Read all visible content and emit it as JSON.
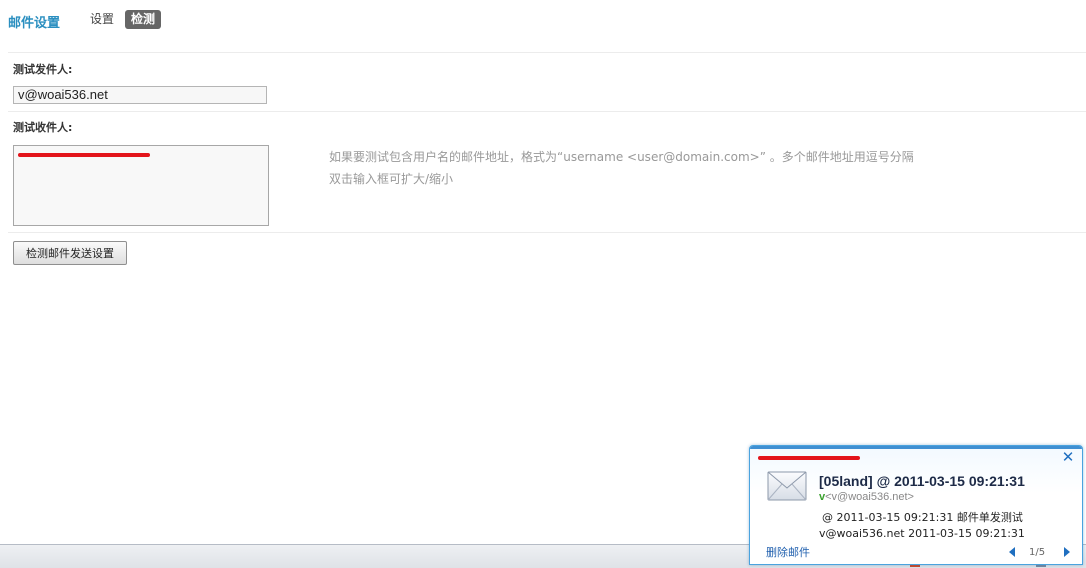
{
  "header": {
    "title": "邮件设置",
    "tabs": [
      {
        "label": "设置",
        "active": false
      },
      {
        "label": "检测",
        "active": true
      }
    ]
  },
  "form": {
    "sender_label": "测试发件人:",
    "sender_value": "v@woai536.net",
    "recipient_label": "测试收件人:",
    "recipient_value": "",
    "hint_line1": "如果要测试包含用户名的邮件地址，格式为“username <user@domain.com>” 。多个邮件地址用逗号分隔",
    "hint_line2": "双击输入框可扩大/缩小",
    "check_button_label": "检测邮件发送设置"
  },
  "notification": {
    "subject": "[05land]  @ 2011-03-15 09:21:31",
    "from_name": "v",
    "from_addr": "<v@woai536.net>",
    "body_line1": "@ 2011-03-15 09:21:31 邮件单发测试",
    "body_line2": "v@woai536.net 2011-03-15 09:21:31",
    "delete_label": "删除邮件",
    "page_indicator": "1/5"
  },
  "colors": {
    "accent": "#2b8fc0",
    "active_tab_bg": "#666666",
    "redaction": "#e3141b",
    "popup_border": "#4aa3de"
  },
  "icons": [
    "envelope-icon",
    "close-icon",
    "arrow-left-icon",
    "arrow-right-icon"
  ]
}
